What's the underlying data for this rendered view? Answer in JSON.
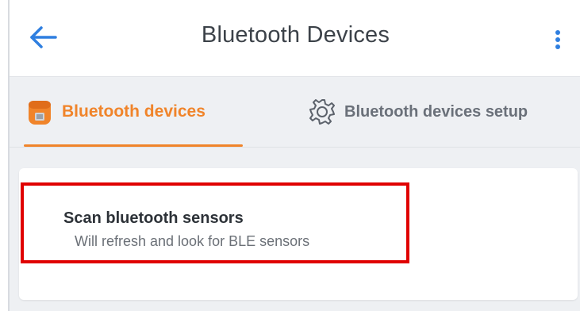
{
  "appbar": {
    "title": "Bluetooth Devices",
    "back_icon": "arrow-left-icon",
    "more_icon": "more-vert-icon"
  },
  "tabs": [
    {
      "label": "Bluetooth devices",
      "icon": "bluetooth-device-icon",
      "active": true
    },
    {
      "label": "Bluetooth devices setup",
      "icon": "gear-icon",
      "active": false
    }
  ],
  "scan_item": {
    "title": "Scan bluetooth sensors",
    "subtitle": "Will refresh and look for BLE sensors"
  },
  "colors": {
    "accent": "#f0842a",
    "back_arrow": "#2f7fe0",
    "more_dots": "#2f7fe0",
    "highlight_border": "#e00000",
    "background": "#eef0f3"
  }
}
